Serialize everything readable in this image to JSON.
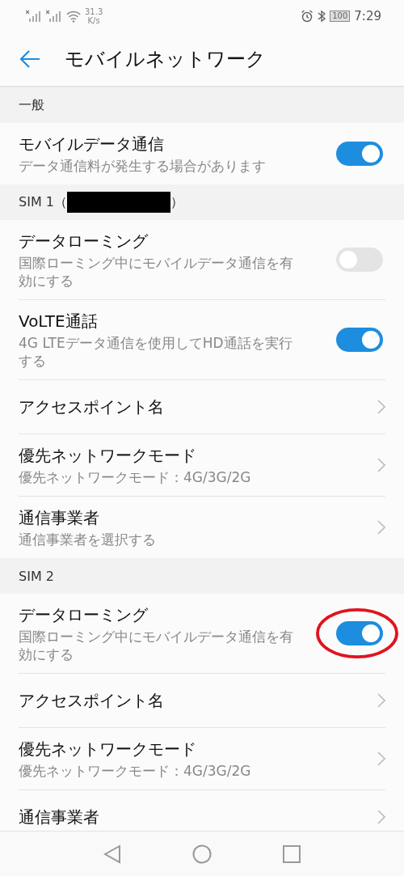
{
  "status_bar": {
    "speed_value": "31.3",
    "speed_unit": "K/s",
    "battery": "100",
    "time": "7:29"
  },
  "app_bar": {
    "title": "モバイルネットワーク"
  },
  "sections": [
    {
      "header": {
        "label": "一般"
      },
      "rows": [
        {
          "kind": "toggle",
          "title": "モバイルデータ通信",
          "subtitle": "データ通信料が発生する場合があります",
          "on": true,
          "circled": false
        }
      ]
    },
    {
      "header": {
        "label": "SIM 1（",
        "redacted": true,
        "suffix": "）"
      },
      "rows": [
        {
          "kind": "toggle",
          "title": "データローミング",
          "subtitle": "国際ローミング中にモバイルデータ通信を有効にする",
          "on": false,
          "circled": false
        },
        {
          "kind": "toggle",
          "title": "VoLTE通話",
          "subtitle": "4G LTEデータ通信を使用してHD通話を実行する",
          "on": true,
          "circled": false
        },
        {
          "kind": "link",
          "title": "アクセスポイント名"
        },
        {
          "kind": "link",
          "title": "優先ネットワークモード",
          "subtitle": "優先ネットワークモード：4G/3G/2G"
        },
        {
          "kind": "link",
          "title": "通信事業者",
          "subtitle": "通信事業者を選択する"
        }
      ]
    },
    {
      "header": {
        "label": "SIM 2"
      },
      "rows": [
        {
          "kind": "toggle",
          "title": "データローミング",
          "subtitle": "国際ローミング中にモバイルデータ通信を有効にする",
          "on": true,
          "circled": true
        },
        {
          "kind": "link",
          "title": "アクセスポイント名"
        },
        {
          "kind": "link",
          "title": "優先ネットワークモード",
          "subtitle": "優先ネットワークモード：4G/3G/2G"
        },
        {
          "kind": "link",
          "title": "通信事業者"
        }
      ]
    }
  ]
}
